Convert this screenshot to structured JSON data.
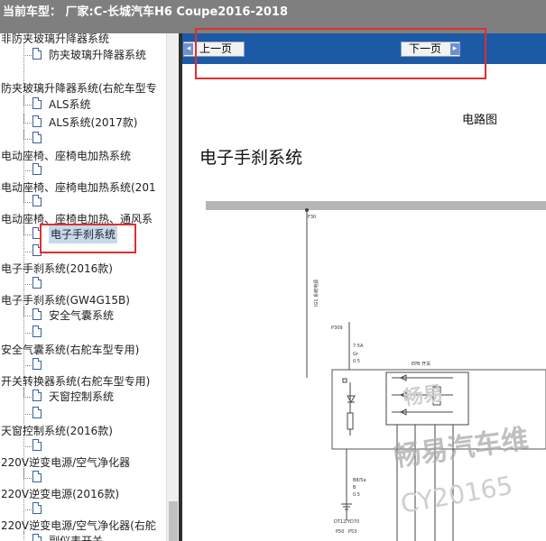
{
  "header": {
    "title": "当前车型： 厂家:C-长城汽车H6 Coupe2016-2018"
  },
  "sidebar": {
    "items": [
      {
        "type": "category",
        "label": "非防夹玻璃升降器系统"
      },
      {
        "type": "leaf",
        "label": "防夹玻璃升降器系统"
      },
      {
        "type": "category",
        "label": "防夹玻璃升降器系统(右舵车型专"
      },
      {
        "type": "leaf",
        "label": "ALS系统"
      },
      {
        "type": "leaf",
        "label": "ALS系统(2017款)"
      },
      {
        "type": "leaf",
        "label": ""
      },
      {
        "type": "category",
        "label": "电动座椅、座椅电加热系统"
      },
      {
        "type": "leaf",
        "label": ""
      },
      {
        "type": "category",
        "label": "电动座椅、座椅电加热系统(201"
      },
      {
        "type": "leaf",
        "label": ""
      },
      {
        "type": "category",
        "label": "电动座椅、座椅电加热、通风系"
      },
      {
        "type": "leaf",
        "label": "电子手刹系统",
        "selected": true
      },
      {
        "type": "leaf",
        "label": ""
      },
      {
        "type": "category",
        "label": "电子手刹系统(2016款)"
      },
      {
        "type": "leaf",
        "label": ""
      },
      {
        "type": "category",
        "label": "电子手刹系统(GW4G15B)"
      },
      {
        "type": "leaf",
        "label": "安全气囊系统"
      },
      {
        "type": "leaf",
        "label": ""
      },
      {
        "type": "category",
        "label": "安全气囊系统(右舵车型专用)"
      },
      {
        "type": "leaf",
        "label": ""
      },
      {
        "type": "category",
        "label": "开关转换器系统(右舵车型专用)"
      },
      {
        "type": "leaf",
        "label": "天窗控制系统"
      },
      {
        "type": "leaf",
        "label": ""
      },
      {
        "type": "category",
        "label": "天窗控制系统(2016款)"
      },
      {
        "type": "leaf",
        "label": ""
      },
      {
        "type": "category",
        "label": "220V逆变电源/空气净化器"
      },
      {
        "type": "leaf",
        "label": ""
      },
      {
        "type": "category",
        "label": "220V逆变电源(2016款)"
      },
      {
        "type": "leaf",
        "label": ""
      },
      {
        "type": "category",
        "label": "220V逆变电源/空气净化器(右舵"
      },
      {
        "type": "leaf",
        "label": "副仪表开关"
      }
    ]
  },
  "nav": {
    "prev_label": "上一页",
    "next_label": "下一页"
  },
  "content": {
    "section_label": "电路图",
    "doc_title": "电子手刹系统"
  },
  "diagram": {
    "labels": {
      "fuse": "F30",
      "fuse_rating": "7.5A",
      "wire_color": "Gr",
      "wire_size": "0.5",
      "connector_top": "P309",
      "module": "EPB 开关",
      "ground_wire": "B",
      "ground_size": "0.5",
      "ground_color": "B8/5a",
      "ground_point": "DT12/YD70",
      "bottom_left": "P50",
      "bottom_right": "P53",
      "vert_label": "IG1 系统电源"
    },
    "watermark": {
      "line1": "畅易汽车维",
      "line2": "CY20165",
      "small": "畅易"
    }
  },
  "colors": {
    "topbar": "#7f7f7f",
    "navbar": "#1c5aa6",
    "annotation": "#e0302a",
    "selection": "#c6d9ee"
  }
}
